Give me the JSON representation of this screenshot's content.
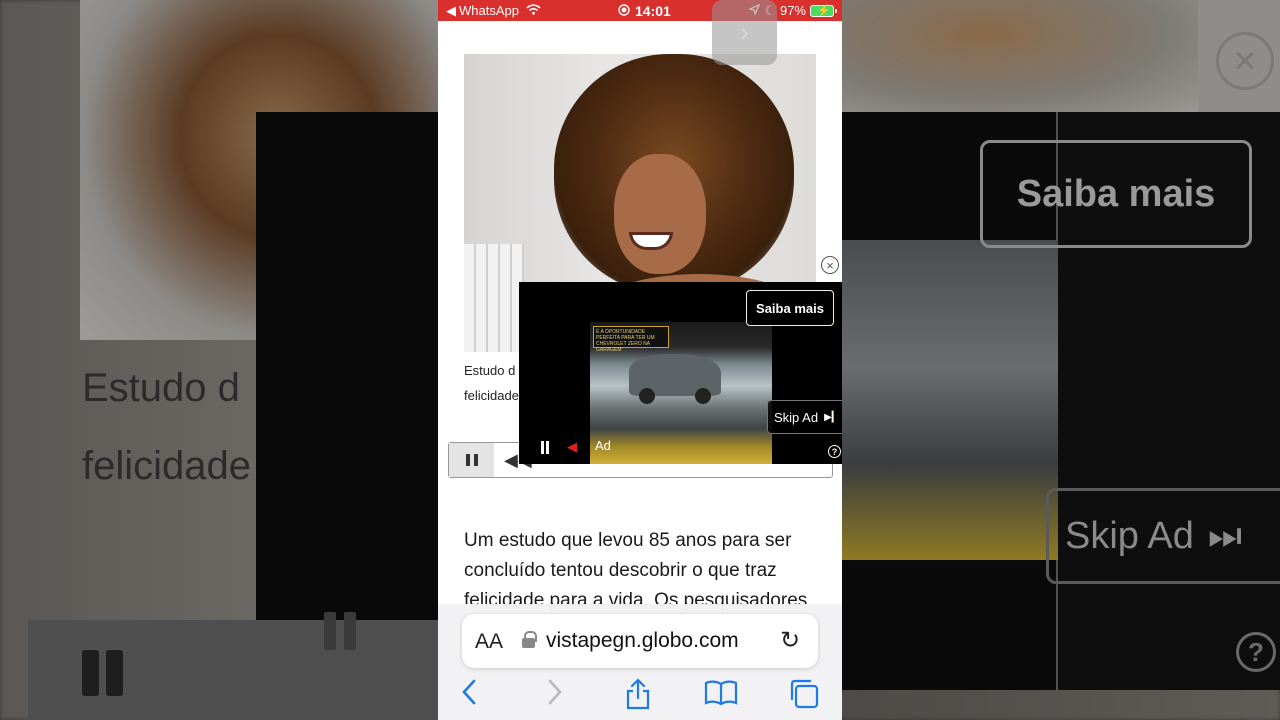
{
  "status_bar": {
    "back_app": "WhatsApp",
    "time": "14:01",
    "battery": "97%"
  },
  "background": {
    "text_line1": "Estudo d",
    "text_line2": "felicidade",
    "saiba_mais": "Saiba mais",
    "skip_ad": "Skip Ad"
  },
  "article": {
    "caption_line1": "Estudo d",
    "caption_line2": "felicidade",
    "body_line1": "Um estudo que levou 85 anos para ser",
    "body_line2": "concluído tentou descobrir o que traz",
    "body_line3": "felicidade para a vida. Os pesquisadores"
  },
  "ad": {
    "headline": "É A OPORTUNIDADE PERFEITA PARA TER UM CHEVROLET ZERO NA GARAGEM",
    "saiba_mais": "Saiba mais",
    "skip_ad": "Skip Ad",
    "label": "Ad"
  },
  "browser": {
    "text_size_label": "AA",
    "url": "vistapegn.globo.com"
  },
  "colors": {
    "status_bar": "#d9302e",
    "accent": "#1e7ae6",
    "mute": "#e02020"
  }
}
